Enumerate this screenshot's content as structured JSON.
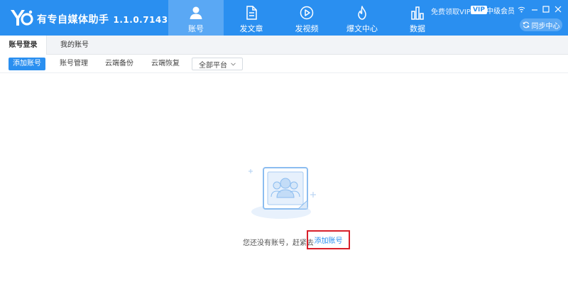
{
  "header": {
    "app_title": "有专自媒体助手",
    "version": "1.1.0.7143",
    "logo_icon": "yo-logo-icon",
    "nav": [
      {
        "label": "账号",
        "icon": "user-icon",
        "active": true
      },
      {
        "label": "发文章",
        "icon": "document-icon",
        "active": false
      },
      {
        "label": "发视频",
        "icon": "play-icon",
        "active": false
      },
      {
        "label": "爆文中心",
        "icon": "flame-icon",
        "active": false
      },
      {
        "label": "数据",
        "icon": "bar-chart-icon",
        "active": false
      }
    ],
    "vip_link": "免费领取VIP",
    "vip_badge": "VIP",
    "member_level": "中级会员",
    "sync_button": "同步中心",
    "window_controls": [
      "wifi-icon",
      "minimize-icon",
      "maximize-icon",
      "close-icon"
    ]
  },
  "tabs": [
    {
      "label": "账号登录",
      "active": true
    },
    {
      "label": "我的账号",
      "active": false
    }
  ],
  "toolbar": {
    "add_account": "添加账号",
    "manage": "账号管理",
    "backup": "云端备份",
    "restore": "云端恢复",
    "platform_select": "全部平台"
  },
  "empty_state": {
    "message": "您还没有账号，赶紧去",
    "action_link": "添加账号",
    "illustration_icon": "users-card-icon"
  },
  "colors": {
    "accent": "#2a8ff0",
    "nav_active": "#5aa8f4",
    "highlight_border": "#d8202a"
  }
}
